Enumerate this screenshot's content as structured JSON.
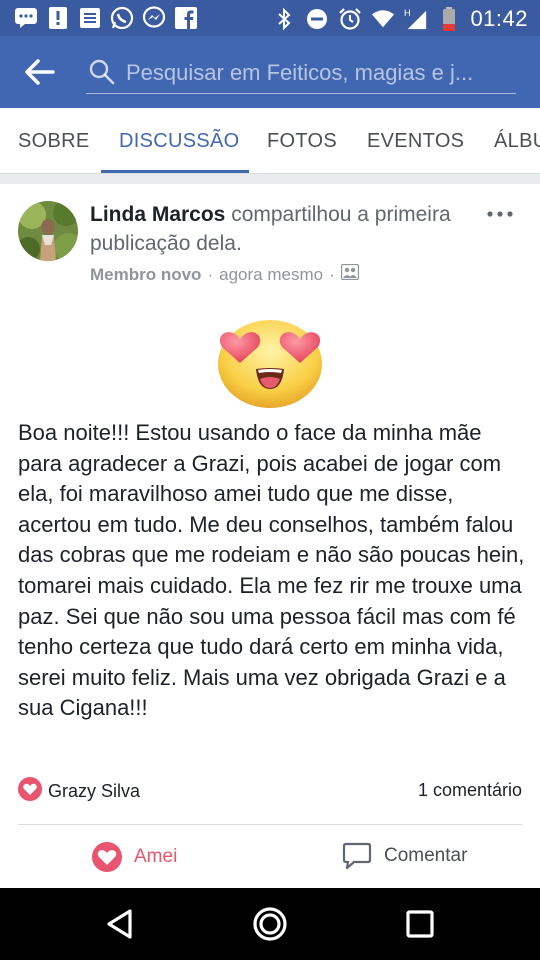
{
  "status_bar": {
    "time": "01:42",
    "left_icons": [
      "message-icon",
      "alert-icon",
      "newspaper-icon",
      "whatsapp-icon",
      "messenger-icon",
      "facebook-icon"
    ],
    "right_icons": [
      "bluetooth-icon",
      "dnd-icon",
      "alarm-icon",
      "wifi-icon",
      "signal-icon",
      "battery-icon"
    ]
  },
  "search": {
    "placeholder": "Pesquisar em Feiticos, magias e j..."
  },
  "tabs": [
    {
      "label": "SOBRE",
      "active": false
    },
    {
      "label": "DISCUSSÃO",
      "active": true
    },
    {
      "label": "FOTOS",
      "active": false
    },
    {
      "label": "EVENTOS",
      "active": false
    },
    {
      "label": "ÁLBUNS",
      "active": false
    }
  ],
  "post": {
    "author": "Linda Marcos",
    "action_text": " compartilhou a primeira publicação dela.",
    "badge": "Membro novo",
    "separator": "·",
    "time": "agora mesmo",
    "privacy_icon": "group-privacy-icon",
    "emoji_icon": "heart-eyes-emoji",
    "body": "Boa noite!!! Estou usando o face da minha mãe para agradecer a Grazi, pois acabei de jogar com ela, foi maravilhoso amei tudo que me disse, acertou em tudo. Me deu conselhos, também falou das cobras que me rodeiam e não são poucas hein, tomarei mais cuidado. Ela me fez rir me trouxe uma paz. Sei que não sou uma pessoa fácil mas com fé tenho certeza que tudo dará certo em minha vida, serei muito feliz. Mais uma vez obrigada Grazi e a sua Cigana!!!",
    "reaction_names": "Grazy Silva",
    "comment_count": "1 comentário",
    "love_label": "Amei",
    "comment_label": "Comentar"
  },
  "colors": {
    "facebook_blue": "#4267b2",
    "status_bar": "#3a5ba0",
    "love_red": "#e9546e",
    "text_primary": "#1d2129",
    "text_secondary": "#90949c"
  }
}
